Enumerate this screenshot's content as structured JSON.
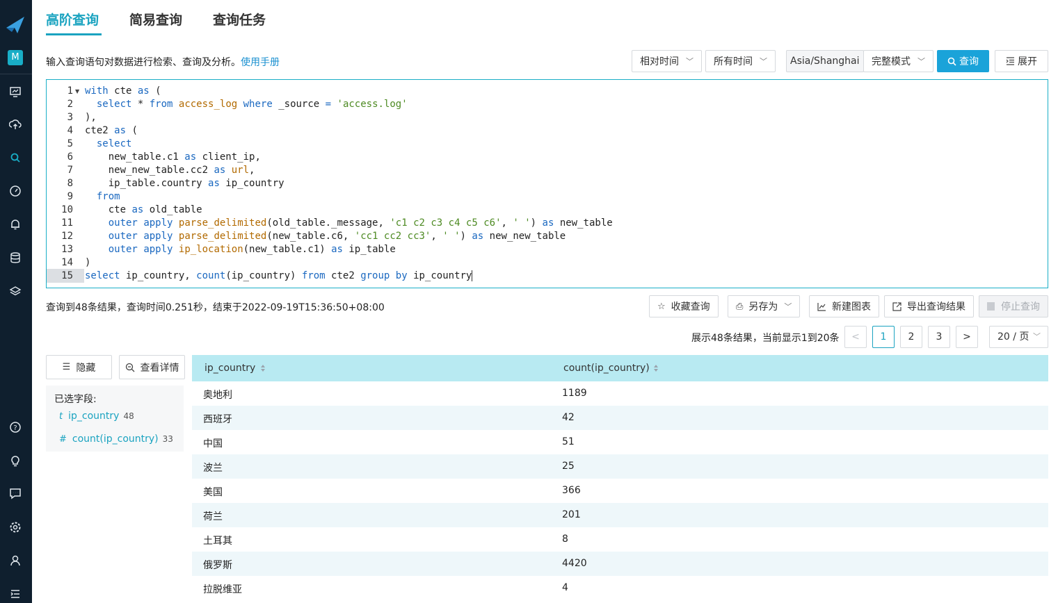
{
  "rail": {
    "avatar": "M",
    "icons": [
      "dashboard-icon",
      "upload-icon",
      "search-icon",
      "gauge-icon",
      "bell-icon",
      "database-icon",
      "layers-icon",
      "help-icon",
      "bulb-icon",
      "message-icon",
      "settings-icon",
      "user-icon",
      "menu-icon"
    ]
  },
  "tabs": [
    "高阶查询",
    "简易查询",
    "查询任务"
  ],
  "hint": {
    "text": "输入查询语句对数据进行检索、查询及分析。",
    "link": "使用手册"
  },
  "toolbar": {
    "relative_time": "相对时间",
    "all_time": "所有时间",
    "timezone": "Asia/Shanghai",
    "mode": "完整模式",
    "query_label": "查询",
    "expand_label": "展开"
  },
  "editor": {
    "line_numbers": [
      "1",
      "2",
      "3",
      "4",
      "5",
      "6",
      "7",
      "8",
      "9",
      "10",
      "11",
      "12",
      "13",
      "14",
      "15"
    ],
    "lines": [
      [
        {
          "t": "with",
          "c": "kw"
        },
        {
          "t": " cte ",
          "c": ""
        },
        {
          "t": "as",
          "c": "kw"
        },
        {
          "t": " (",
          "c": ""
        }
      ],
      [
        {
          "t": "  ",
          "c": ""
        },
        {
          "t": "select",
          "c": "kw"
        },
        {
          "t": " * ",
          "c": ""
        },
        {
          "t": "from",
          "c": "kw"
        },
        {
          "t": " ",
          "c": ""
        },
        {
          "t": "access_log",
          "c": "fn"
        },
        {
          "t": " ",
          "c": ""
        },
        {
          "t": "where",
          "c": "kw"
        },
        {
          "t": " _source ",
          "c": ""
        },
        {
          "t": "=",
          "c": "op"
        },
        {
          "t": " ",
          "c": ""
        },
        {
          "t": "'access.log'",
          "c": "str"
        }
      ],
      [
        {
          "t": "),",
          "c": ""
        }
      ],
      [
        {
          "t": "cte2 ",
          "c": ""
        },
        {
          "t": "as",
          "c": "kw"
        },
        {
          "t": " (",
          "c": ""
        }
      ],
      [
        {
          "t": "  ",
          "c": ""
        },
        {
          "t": "select",
          "c": "kw"
        }
      ],
      [
        {
          "t": "    new_table.c1 ",
          "c": ""
        },
        {
          "t": "as",
          "c": "kw"
        },
        {
          "t": " client_ip,",
          "c": ""
        }
      ],
      [
        {
          "t": "    new_new_table.cc2 ",
          "c": ""
        },
        {
          "t": "as",
          "c": "kw"
        },
        {
          "t": " ",
          "c": ""
        },
        {
          "t": "url",
          "c": "fn"
        },
        {
          "t": ",",
          "c": ""
        }
      ],
      [
        {
          "t": "    ip_table.country ",
          "c": ""
        },
        {
          "t": "as",
          "c": "kw"
        },
        {
          "t": " ip_country",
          "c": ""
        }
      ],
      [
        {
          "t": "  ",
          "c": ""
        },
        {
          "t": "from",
          "c": "kw"
        }
      ],
      [
        {
          "t": "    cte ",
          "c": ""
        },
        {
          "t": "as",
          "c": "kw"
        },
        {
          "t": " old_table",
          "c": ""
        }
      ],
      [
        {
          "t": "    ",
          "c": ""
        },
        {
          "t": "outer",
          "c": "kw"
        },
        {
          "t": " ",
          "c": ""
        },
        {
          "t": "apply",
          "c": "kw"
        },
        {
          "t": " ",
          "c": ""
        },
        {
          "t": "parse_delimited",
          "c": "fn"
        },
        {
          "t": "(old_table._message, ",
          "c": ""
        },
        {
          "t": "'c1 c2 c3 c4 c5 c6'",
          "c": "str"
        },
        {
          "t": ", ",
          "c": ""
        },
        {
          "t": "' '",
          "c": "str"
        },
        {
          "t": ") ",
          "c": ""
        },
        {
          "t": "as",
          "c": "kw"
        },
        {
          "t": " new_table",
          "c": ""
        }
      ],
      [
        {
          "t": "    ",
          "c": ""
        },
        {
          "t": "outer",
          "c": "kw"
        },
        {
          "t": " ",
          "c": ""
        },
        {
          "t": "apply",
          "c": "kw"
        },
        {
          "t": " ",
          "c": ""
        },
        {
          "t": "parse_delimited",
          "c": "fn"
        },
        {
          "t": "(new_table.c6, ",
          "c": ""
        },
        {
          "t": "'cc1 cc2 cc3'",
          "c": "str"
        },
        {
          "t": ", ",
          "c": ""
        },
        {
          "t": "' '",
          "c": "str"
        },
        {
          "t": ") ",
          "c": ""
        },
        {
          "t": "as",
          "c": "kw"
        },
        {
          "t": " new_new_table",
          "c": ""
        }
      ],
      [
        {
          "t": "    ",
          "c": ""
        },
        {
          "t": "outer",
          "c": "kw"
        },
        {
          "t": " ",
          "c": ""
        },
        {
          "t": "apply",
          "c": "kw"
        },
        {
          "t": " ",
          "c": ""
        },
        {
          "t": "ip_location",
          "c": "fn"
        },
        {
          "t": "(new_table.c1) ",
          "c": ""
        },
        {
          "t": "as",
          "c": "kw"
        },
        {
          "t": " ip_table",
          "c": ""
        }
      ],
      [
        {
          "t": ")",
          "c": ""
        }
      ],
      [
        {
          "t": "select",
          "c": "kw"
        },
        {
          "t": " ip_country, ",
          "c": ""
        },
        {
          "t": "count",
          "c": "kw"
        },
        {
          "t": "(ip_country) ",
          "c": ""
        },
        {
          "t": "from",
          "c": "kw"
        },
        {
          "t": " cte2 ",
          "c": ""
        },
        {
          "t": "group",
          "c": "kw"
        },
        {
          "t": " ",
          "c": ""
        },
        {
          "t": "by",
          "c": "kw"
        },
        {
          "t": " ip_country",
          "c": ""
        }
      ]
    ]
  },
  "result": {
    "summary": "查询到48条结果，查询时间0.251秒，结束于2022-09-19T15:36:50+08:00",
    "actions": {
      "favorite": "收藏查询",
      "save_as": "另存为",
      "new_chart": "新建图表",
      "export": "导出查询结果",
      "stop": "停止查询"
    }
  },
  "pagination": {
    "info": "展示48条结果，当前显示1到20条",
    "prev": "<",
    "pages": [
      "1",
      "2",
      "3"
    ],
    "next": ">",
    "page_size": "20 / 页"
  },
  "left_panel": {
    "hide_label": "隐藏",
    "details_label": "查看详情",
    "selected_title": "已选字段:",
    "fields": [
      {
        "type": "t",
        "name": "ip_country",
        "count": "48"
      },
      {
        "type": "#",
        "name": "count(ip_country)",
        "count": "33"
      }
    ]
  },
  "table": {
    "columns": [
      "ip_country",
      "count(ip_country)"
    ],
    "rows": [
      [
        "奥地利",
        "1189"
      ],
      [
        "西班牙",
        "42"
      ],
      [
        "中国",
        "51"
      ],
      [
        "波兰",
        "25"
      ],
      [
        "美国",
        "366"
      ],
      [
        "荷兰",
        "201"
      ],
      [
        "土耳其",
        "8"
      ],
      [
        "俄罗斯",
        "4420"
      ],
      [
        "拉脱维亚",
        "4"
      ]
    ]
  },
  "colors": {
    "accent": "#1aa3c0",
    "primary_button": "#1aa3d9",
    "header_bg": "#b8eaf2",
    "rail_bg": "#0f1f2e"
  }
}
